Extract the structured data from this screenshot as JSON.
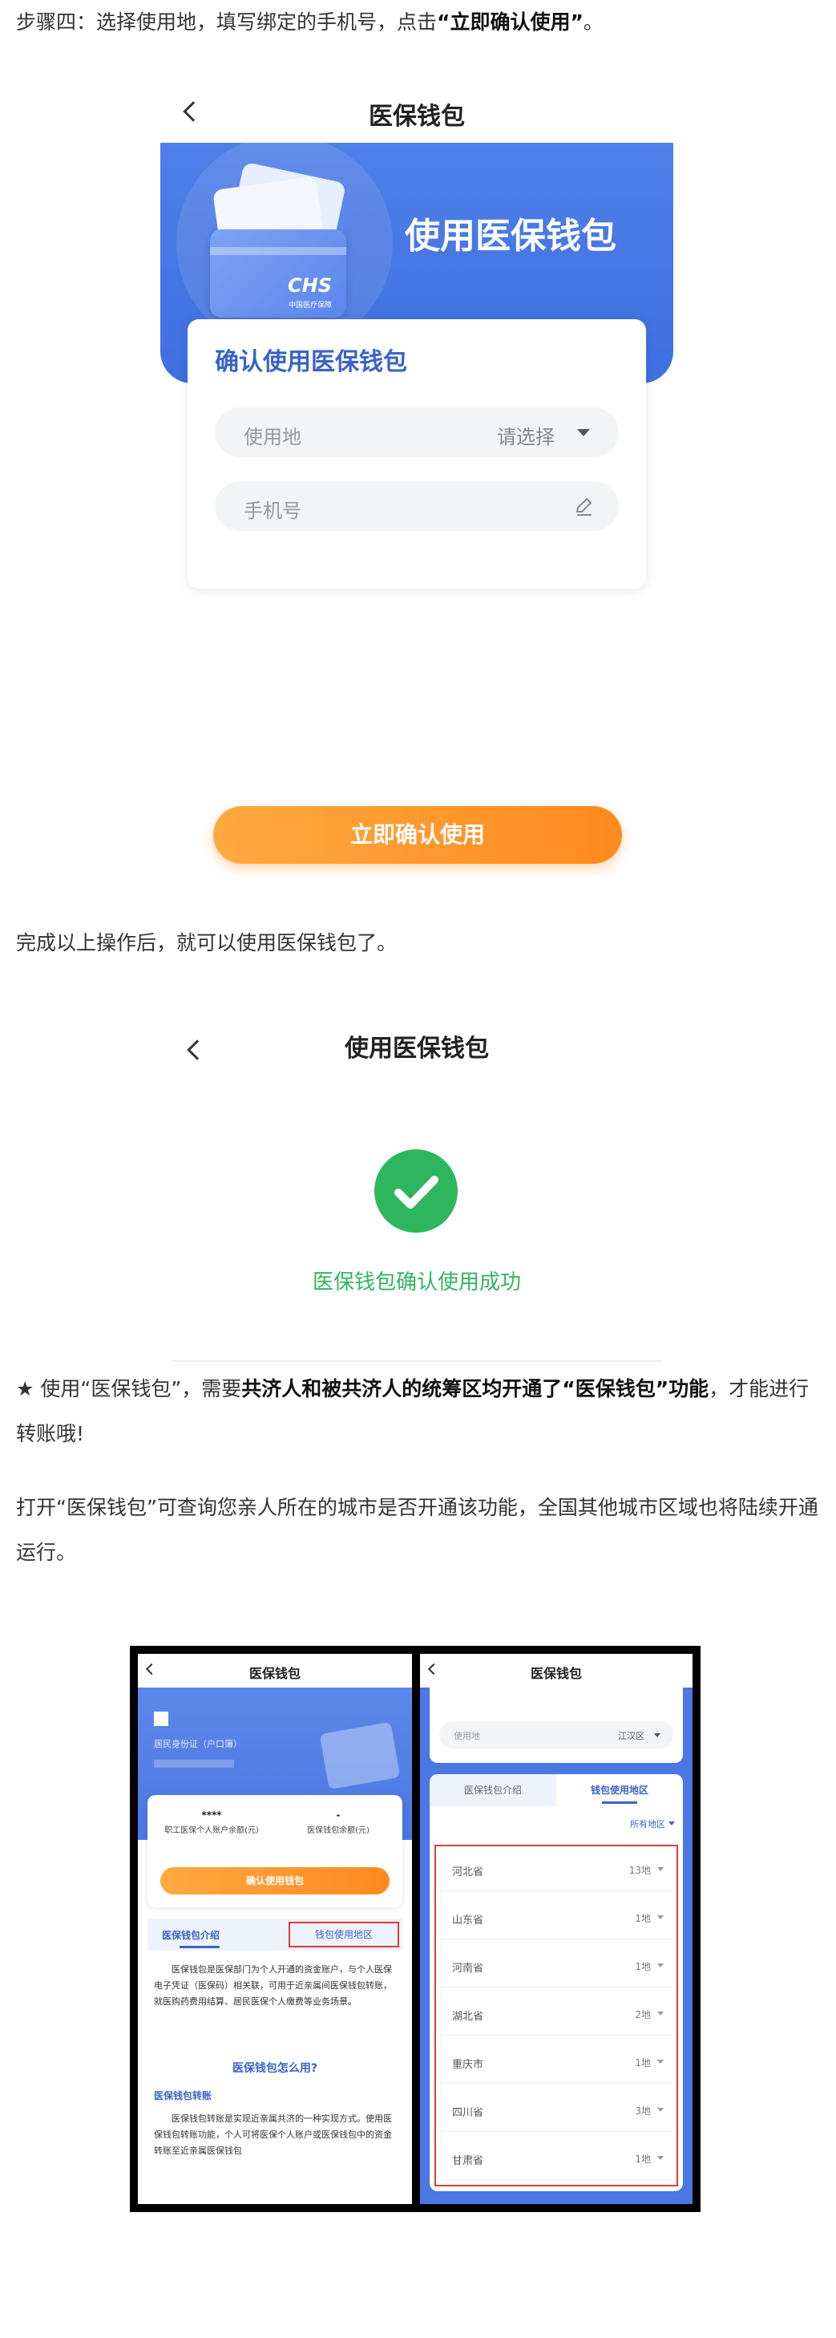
{
  "step4": {
    "prefix": "步骤四：选择使用地，填写绑定的手机号，点击",
    "highlight": "“立即确认使用”",
    "suffix": "。"
  },
  "screen1": {
    "title": "医保钱包",
    "banner_text": "使用医保钱包",
    "card_logo": "CHS",
    "card_logo_sub": "中国医疗保障",
    "form_title": "确认使用医保钱包",
    "location_label": "使用地",
    "location_placeholder": "请选择",
    "phone_label": "手机号",
    "confirm_button": "立即确认使用"
  },
  "after_text": "完成以上操作后，就可以使用医保钱包了。",
  "screen2": {
    "title": "使用医保钱包",
    "success_text": "医保钱包确认使用成功"
  },
  "note": {
    "star": "★",
    "p1": " 使用“医保钱包”，需要",
    "bold": "共济人和被共济人的统筹区均开通了“医保钱包”功能",
    "p2": "，才能进行转账哦!"
  },
  "para2": "打开“医保钱包”可查询您亲人所在的城市是否开通该功能，全国其他城市区域也将陆续开通运行。",
  "left_panel": {
    "title": "医保钱包",
    "id_label": "居民身份证（户口簿）",
    "balance1_value": "****",
    "balance1_label": "职工医保个人账户余额(元)",
    "balance2_value": "-",
    "balance2_label": "医保钱包余额(元)",
    "confirm_button": "确认使用钱包",
    "tab1": "医保钱包介绍",
    "tab2": "钱包使用地区",
    "intro": "医保钱包是医保部门为个人开通的资金账户，与个人医保电子凭证（医保码）相关联，可用于近亲属间医保钱包转账，就医购药费用结算、居民医保个人缴费等业务场景。",
    "how_title": "医保钱包怎么用?",
    "transfer_title": "医保钱包转账",
    "transfer_text": "医保钱包转账是实现近亲属共济的一种实现方式。使用医保钱包转账功能，个人可将医保个人账户或医保钱包中的资金转账至近亲属医保钱包"
  },
  "right_panel": {
    "title": "医保钱包",
    "location_label": "使用地",
    "location_value": "江汉区",
    "tab1": "医保钱包介绍",
    "tab2": "钱包使用地区",
    "filter": "所有地区",
    "regions": [
      {
        "province": "河北省",
        "count": "13地"
      },
      {
        "province": "山东省",
        "count": "1地"
      },
      {
        "province": "河南省",
        "count": "1地"
      },
      {
        "province": "湖北省",
        "count": "2地"
      },
      {
        "province": "重庆市",
        "count": "1地"
      },
      {
        "province": "四川省",
        "count": "3地"
      },
      {
        "province": "甘肃省",
        "count": "1地"
      }
    ]
  },
  "colors": {
    "brand_blue": "#3f6fe0",
    "orange": "#ff8a1f",
    "success_green": "#2fb55d",
    "highlight_red": "#e23b3b"
  }
}
